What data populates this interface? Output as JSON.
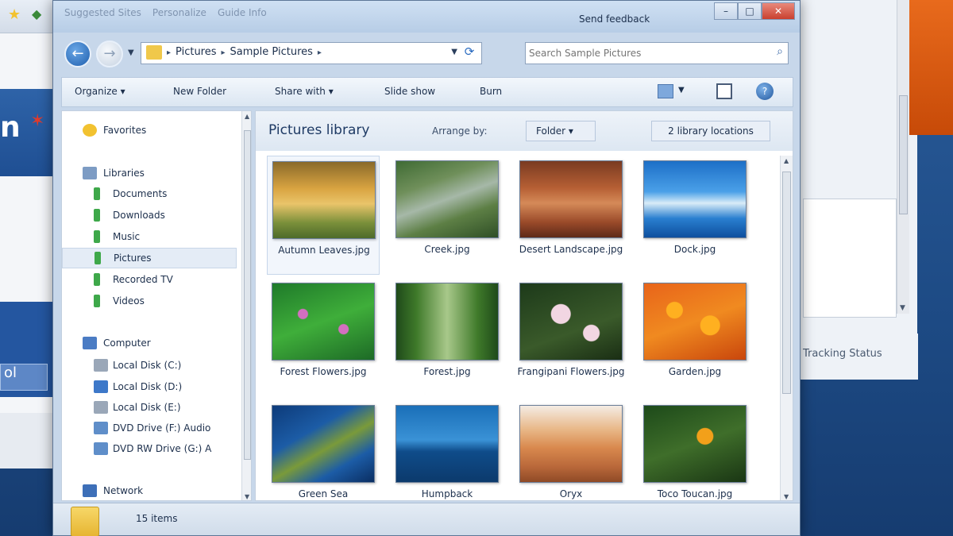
{
  "window": {
    "title_tabs": [
      "Suggested Sites",
      "Personalize",
      "Guide Info"
    ],
    "send_feedback": "Send feedback",
    "controls": {
      "minimize": "–",
      "maximize": "□",
      "close": "✕"
    }
  },
  "address": {
    "crumbs": [
      "Pictures",
      "Sample Pictures"
    ],
    "search_placeholder": "Search Sample Pictures"
  },
  "toolbar": {
    "organize": "Organize ▾",
    "new_folder": "New Folder",
    "share_with": "Share with ▾",
    "slide_show": "Slide show",
    "burn": "Burn"
  },
  "nav": {
    "favorites": "Favorites",
    "libraries": "Libraries",
    "library_items": [
      "Documents",
      "Downloads",
      "Music",
      "Pictures",
      "Recorded TV",
      "Videos"
    ],
    "computer": "Computer",
    "drives": [
      "Local Disk (C:)",
      "Local Disk (D:)",
      "Local Disk (E:)",
      "DVD Drive (F:) Audio",
      "DVD RW Drive (G:) A"
    ],
    "network": "Network"
  },
  "library": {
    "title": "Pictures library",
    "arrange_label": "Arrange by:",
    "arrange_value": "Folder",
    "locations": "2 library locations"
  },
  "items": [
    {
      "name": "Autumn Leaves.jpg"
    },
    {
      "name": "Creek.jpg"
    },
    {
      "name": "Desert Landscape.jpg"
    },
    {
      "name": "Dock.jpg"
    },
    {
      "name": "Forest Flowers.jpg"
    },
    {
      "name": "Forest.jpg"
    },
    {
      "name": "Frangipani Flowers.jpg"
    },
    {
      "name": "Garden.jpg"
    },
    {
      "name": "Green Sea"
    },
    {
      "name": "Humpback"
    },
    {
      "name": "Oryx"
    },
    {
      "name": "Toco Toucan.jpg"
    }
  ],
  "status": {
    "count": "15 items"
  },
  "background": {
    "right_footer": "Tracking Status"
  }
}
